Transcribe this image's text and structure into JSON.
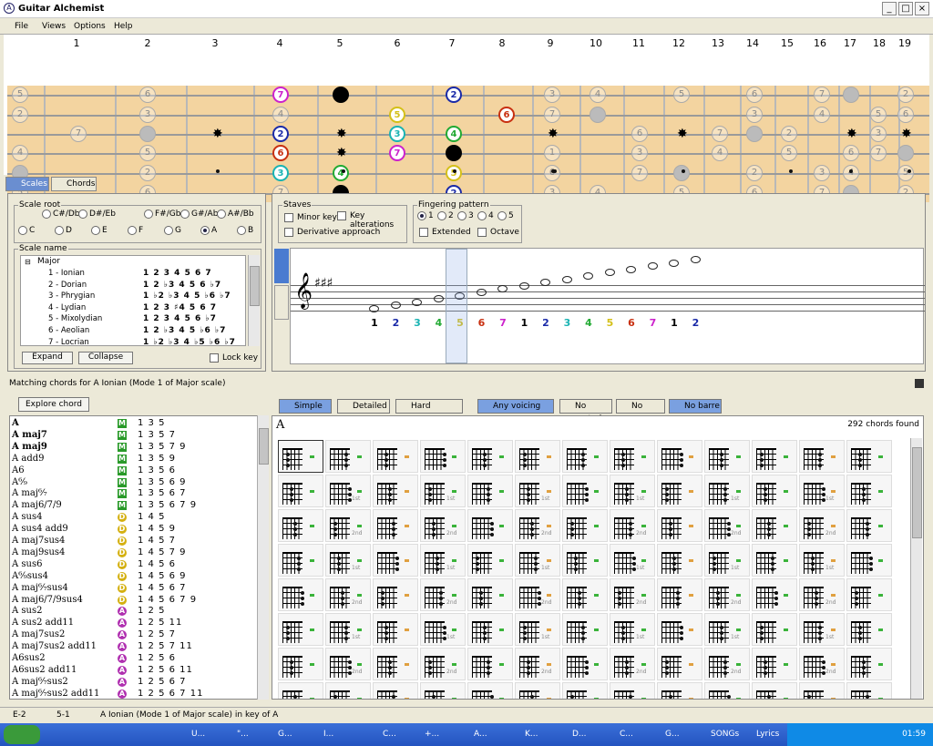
{
  "app": {
    "title": "Guitar Alchemist"
  },
  "menu": [
    "File",
    "Views",
    "Options",
    "Help"
  ],
  "fret_numbers": [
    "1",
    "2",
    "3",
    "4",
    "5",
    "6",
    "7",
    "8",
    "9",
    "10",
    "11",
    "12",
    "13",
    "14",
    "15",
    "16",
    "17",
    "18",
    "19"
  ],
  "tabs": {
    "scales": "Scales",
    "chords": "Chords"
  },
  "scale_root": {
    "label": "Scale root",
    "options": [
      "C#/Db",
      "D#/Eb",
      "F#/Gb",
      "G#/Ab",
      "A#/Bb",
      "C",
      "D",
      "E",
      "F",
      "G",
      "A",
      "B"
    ],
    "selected": "A"
  },
  "scale_name": {
    "label": "Scale name",
    "group": "Major",
    "modes": [
      {
        "name": "1 - Ionian",
        "degrees": "1 2 3 4 5 6 7"
      },
      {
        "name": "2 - Dorian",
        "degrees": "1 2 ♭3 4 5 6 ♭7"
      },
      {
        "name": "3 - Phrygian",
        "degrees": "1 ♭2 ♭3 4 5 ♭6 ♭7"
      },
      {
        "name": "4 - Lydian",
        "degrees": "1 2 3 ♯4 5 6 7"
      },
      {
        "name": "5 - Mixolydian",
        "degrees": "1 2 3 4 5 6 ♭7"
      },
      {
        "name": "6 - Aeolian",
        "degrees": "1 2 ♭3 4 5 ♭6 ♭7"
      },
      {
        "name": "7 - Locrian",
        "degrees": "1 ♭2 ♭3 4 ♭5 ♭6 ♭7"
      }
    ],
    "expand": "Expand",
    "collapse": "Collapse",
    "lock_key": "Lock key"
  },
  "staves": {
    "label": "Staves",
    "minor_key": "Minor key",
    "key_alterations": "Key alterations",
    "derivative": "Derivative approach"
  },
  "fingering": {
    "label": "Fingering pattern",
    "options": [
      "1",
      "2",
      "3",
      "4",
      "5"
    ],
    "extended": "Extended",
    "octave": "Octave"
  },
  "staff_degrees": [
    "1",
    "2",
    "3",
    "4",
    "5",
    "6",
    "7",
    "1",
    "2",
    "3",
    "4",
    "5",
    "6",
    "7",
    "1",
    "2"
  ],
  "degree_colors": {
    "1": "#000000",
    "2": "#1a2aa8",
    "3": "#19b3b3",
    "4": "#22aa33",
    "5": "#d4c019",
    "6": "#c83010",
    "7": "#cc22cc"
  },
  "matching_text": "Matching chords for A Ionian (Mode 1 of Major scale)",
  "explore_chord": "Explore chord",
  "chords": [
    {
      "name": "A",
      "type": "M",
      "iv": "1 3 5",
      "bold": true
    },
    {
      "name": "A maj7",
      "type": "M",
      "iv": "1 3 5 7",
      "bold": true
    },
    {
      "name": "A maj9",
      "type": "M",
      "iv": "1 3 5 7 9",
      "bold": true
    },
    {
      "name": "A add9",
      "type": "M",
      "iv": "1 3 5 9"
    },
    {
      "name": "A6",
      "type": "M",
      "iv": "1 3 5 6"
    },
    {
      "name": "A⁶⁄₉",
      "type": "M",
      "iv": "1 3 5 6 9"
    },
    {
      "name": "A maj⁶⁄₇",
      "type": "M",
      "iv": "1 3 5 6 7"
    },
    {
      "name": "A maj6/7/9",
      "type": "M",
      "iv": "1 3 5 6 7 9"
    },
    {
      "name": "A sus4",
      "type": "D",
      "iv": "1 4 5"
    },
    {
      "name": "A sus4 add9",
      "type": "D",
      "iv": "1 4 5 9"
    },
    {
      "name": "A maj7sus4",
      "type": "D",
      "iv": "1 4 5 7"
    },
    {
      "name": "A maj9sus4",
      "type": "D",
      "iv": "1 4 5 7 9"
    },
    {
      "name": "A sus6",
      "type": "D",
      "iv": "1 4 5 6"
    },
    {
      "name": "A⁶⁄₉sus4",
      "type": "D",
      "iv": "1 4 5 6 9"
    },
    {
      "name": "A maj⁶⁄₇sus4",
      "type": "D",
      "iv": "1 4 5 6 7"
    },
    {
      "name": "A maj6/7/9sus4",
      "type": "D",
      "iv": "1 4 5 6 7 9"
    },
    {
      "name": "A sus2",
      "type": "A",
      "iv": "1 2 5"
    },
    {
      "name": "A sus2 add11",
      "type": "A",
      "iv": "1 2 5 11"
    },
    {
      "name": "A maj7sus2",
      "type": "A",
      "iv": "1 2 5 7"
    },
    {
      "name": "A maj7sus2 add11",
      "type": "A",
      "iv": "1 2 5 7 11"
    },
    {
      "name": "A6sus2",
      "type": "A",
      "iv": "1 2 5 6"
    },
    {
      "name": "A6sus2 add11",
      "type": "A",
      "iv": "1 2 5 6 11"
    },
    {
      "name": "A maj⁶⁄₇sus2",
      "type": "A",
      "iv": "1 2 5 6 7"
    },
    {
      "name": "A maj⁶⁄₇sus2 add11",
      "type": "A",
      "iv": "1 2 5 6 7 11"
    }
  ],
  "chord_toolbar": {
    "simple": "Simple",
    "detailed": "Detailed",
    "hard": "Hard",
    "any_voicing": "Any voicing",
    "no_muted": "No muted",
    "no_open": "No open",
    "no_barre": "No barre"
  },
  "grid": {
    "chord": "A",
    "found": "292 chords found",
    "position_labels": [
      "1st",
      "/C#",
      "2nd",
      "/E"
    ]
  },
  "status": {
    "s1": "E-2",
    "s2": "5-1",
    "s3": "A Ionian (Mode 1 of Major scale) in key of A"
  },
  "taskbar": {
    "items": [
      "U...",
      "\"...",
      "G...",
      "I...",
      "C...",
      "+...",
      "A...",
      "K...",
      "D...",
      "C...",
      "G...",
      "SONGs",
      "Lyrics"
    ],
    "time": "01:59"
  }
}
